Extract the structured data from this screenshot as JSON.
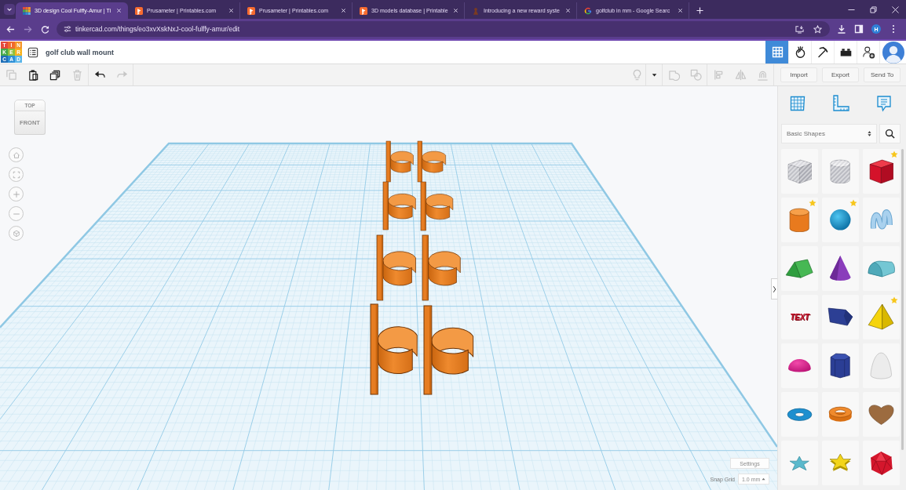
{
  "browser": {
    "tabs": [
      {
        "title": "3D design Cool Fulffy-Amur | Ti",
        "kind": "grid",
        "selected": true
      },
      {
        "title": "Prusameter | Printables.com",
        "kind": "printables",
        "selected": false
      },
      {
        "title": "Prusameter | Printables.com",
        "kind": "printables",
        "selected": false
      },
      {
        "title": "3D models database | Printable",
        "kind": "printables",
        "selected": false
      },
      {
        "title": "Introducing a new reward syste",
        "kind": "photo",
        "selected": false
      },
      {
        "title": "golfclub in mm - Google Searc",
        "kind": "google",
        "selected": false
      }
    ],
    "url": "tinkercad.com/things/eo3xvXskNxJ-cool-fulffy-amur/edit",
    "profile_initial": "H"
  },
  "app": {
    "logo": [
      "T",
      "I",
      "N",
      "K",
      "E",
      "R",
      "C",
      "A",
      "D"
    ],
    "design_title": "golf club wall mount",
    "modes": [
      {
        "kind": "grid",
        "selected": true
      },
      {
        "kind": "ball",
        "selected": false
      },
      {
        "kind": "pickaxe",
        "selected": false
      },
      {
        "kind": "brick",
        "selected": false
      }
    ]
  },
  "toolbar": {
    "left_groups": [
      [
        {
          "kind": "copy",
          "disabled": true
        },
        {
          "kind": "paste",
          "disabled": false
        },
        {
          "kind": "duplicate",
          "disabled": false
        },
        {
          "kind": "delete",
          "disabled": true
        }
      ],
      [
        {
          "kind": "undo",
          "disabled": false
        },
        {
          "kind": "redo",
          "disabled": true
        }
      ]
    ],
    "right_groups": [
      [
        {
          "kind": "bulb",
          "disabled": true
        }
      ],
      [
        {
          "kind": "caret",
          "disabled": false
        }
      ],
      [
        {
          "kind": "group",
          "disabled": true
        },
        {
          "kind": "ungroup",
          "disabled": true
        }
      ],
      [
        {
          "kind": "align",
          "disabled": true
        },
        {
          "kind": "mirror",
          "disabled": true
        },
        {
          "kind": "cruise",
          "disabled": true
        }
      ]
    ],
    "actions": [
      "Import",
      "Export",
      "Send To"
    ]
  },
  "view_cube": {
    "top": "TOP",
    "front": "FRONT"
  },
  "shapes_panel": {
    "category": "Basic Shapes",
    "shapes": [
      {
        "kind": "boxhole",
        "starred": false
      },
      {
        "kind": "cylinderhole",
        "starred": false
      },
      {
        "kind": "box",
        "starred": true
      },
      {
        "kind": "cylinder",
        "starred": true
      },
      {
        "kind": "sphere",
        "starred": true
      },
      {
        "kind": "scribble",
        "starred": false
      },
      {
        "kind": "roof",
        "starred": false
      },
      {
        "kind": "cone",
        "starred": false
      },
      {
        "kind": "roundroof",
        "starred": false
      },
      {
        "kind": "text",
        "label": "TEXT",
        "starred": false
      },
      {
        "kind": "wedge",
        "starred": false
      },
      {
        "kind": "pyramid",
        "starred": true
      },
      {
        "kind": "halfsphere",
        "starred": false
      },
      {
        "kind": "polygon",
        "starred": false
      },
      {
        "kind": "paraboloid",
        "starred": false
      },
      {
        "kind": "torus",
        "starred": false
      },
      {
        "kind": "tube",
        "starred": false
      },
      {
        "kind": "heart",
        "starred": false
      },
      {
        "kind": "star",
        "starred": false
      },
      {
        "kind": "starprism",
        "starred": false
      },
      {
        "kind": "icosahedron",
        "starred": false
      }
    ]
  },
  "footer": {
    "settings": "Settings",
    "snap_label": "Snap Grid",
    "snap_value": "1.0 mm"
  }
}
